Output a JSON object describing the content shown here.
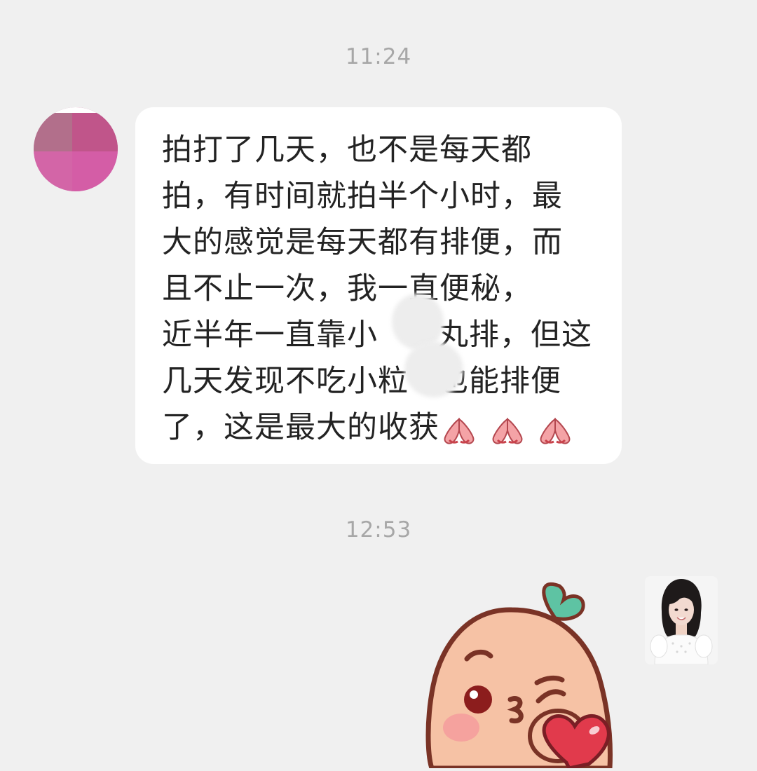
{
  "timestamps": [
    "11:24",
    "12:53"
  ],
  "incoming_message": {
    "lines": [
      "拍打了几天，也不是每天都",
      "拍，有时间就拍半个小时，最",
      "大的感觉是每天都有排便，而",
      "且不止一次，我一直便秘，",
      "近半年一直靠小",
      "丸排，但这",
      "几天发现不吃小粒",
      "也能排便",
      "了，这是最大的收获"
    ],
    "emoji": [
      "praying-hands-icon",
      "praying-hands-icon",
      "praying-hands-icon"
    ]
  },
  "outgoing_message": {
    "type": "sticker",
    "icon": "peach-kiss-heart-sticker"
  },
  "colors": {
    "background": "#f0f0f0",
    "bubble": "#ffffff",
    "text": "#232323",
    "timestamp": "#a7a7a7",
    "peach_body": "#f6c2a5",
    "peach_outline": "#7a3326",
    "leaf": "#5ec3a3",
    "heart": "#e13a4c"
  }
}
